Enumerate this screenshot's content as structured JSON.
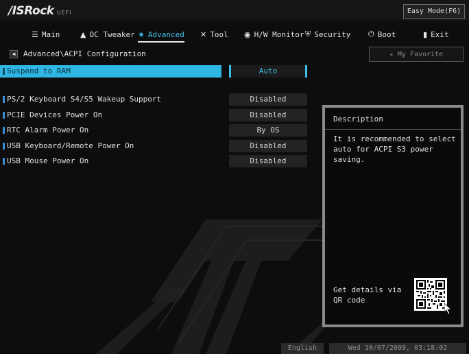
{
  "brand": {
    "logo": "/ISRock",
    "sub": "UEFI"
  },
  "easy_mode": "Easy Mode(F6)",
  "tabs": [
    {
      "label": "Main",
      "icon": "menu-list-icon",
      "glyph": "☰"
    },
    {
      "label": "OC Tweaker",
      "icon": "rocket-icon",
      "glyph": "▲"
    },
    {
      "label": "Advanced",
      "icon": "star-icon",
      "glyph": "★"
    },
    {
      "label": "Tool",
      "icon": "tools-icon",
      "glyph": "✕"
    },
    {
      "label": "H/W Monitor",
      "icon": "monitor-icon",
      "glyph": "◉"
    },
    {
      "label": "Security",
      "icon": "shield-icon",
      "glyph": "⛨"
    },
    {
      "label": "Boot",
      "icon": "power-icon",
      "glyph": "⏻"
    },
    {
      "label": "Exit",
      "icon": "exit-icon",
      "glyph": "▮"
    }
  ],
  "active_tab": "Advanced",
  "breadcrumb": "Advanced\\ACPI Configuration",
  "favorite": {
    "label": "My Favorite",
    "icon": "star-icon"
  },
  "settings": [
    {
      "label": "Suspend to RAM",
      "value": "Auto",
      "selected": true
    },
    {
      "label": "PS/2 Keyboard S4/S5 Wakeup Support",
      "value": "Disabled",
      "selected": false
    },
    {
      "label": "PCIE Devices Power On",
      "value": "Disabled",
      "selected": false
    },
    {
      "label": "RTC Alarm Power On",
      "value": "By OS",
      "selected": false
    },
    {
      "label": "USB Keyboard/Remote Power On",
      "value": "Disabled",
      "selected": false
    },
    {
      "label": "USB Mouse Power On",
      "value": "Disabled",
      "selected": false
    }
  ],
  "description": {
    "title": "Description",
    "text": "It is recommended to select auto for ACPI S3 power saving.",
    "qr_text": "Get details via QR code"
  },
  "footer": {
    "language": "English",
    "datetime": "Wed 10/07/2099, 03:18:02"
  },
  "colors": {
    "accent": "#3fc0e8",
    "selected_row": "#2fb6e4",
    "panel_border": "#8a8a8a"
  }
}
